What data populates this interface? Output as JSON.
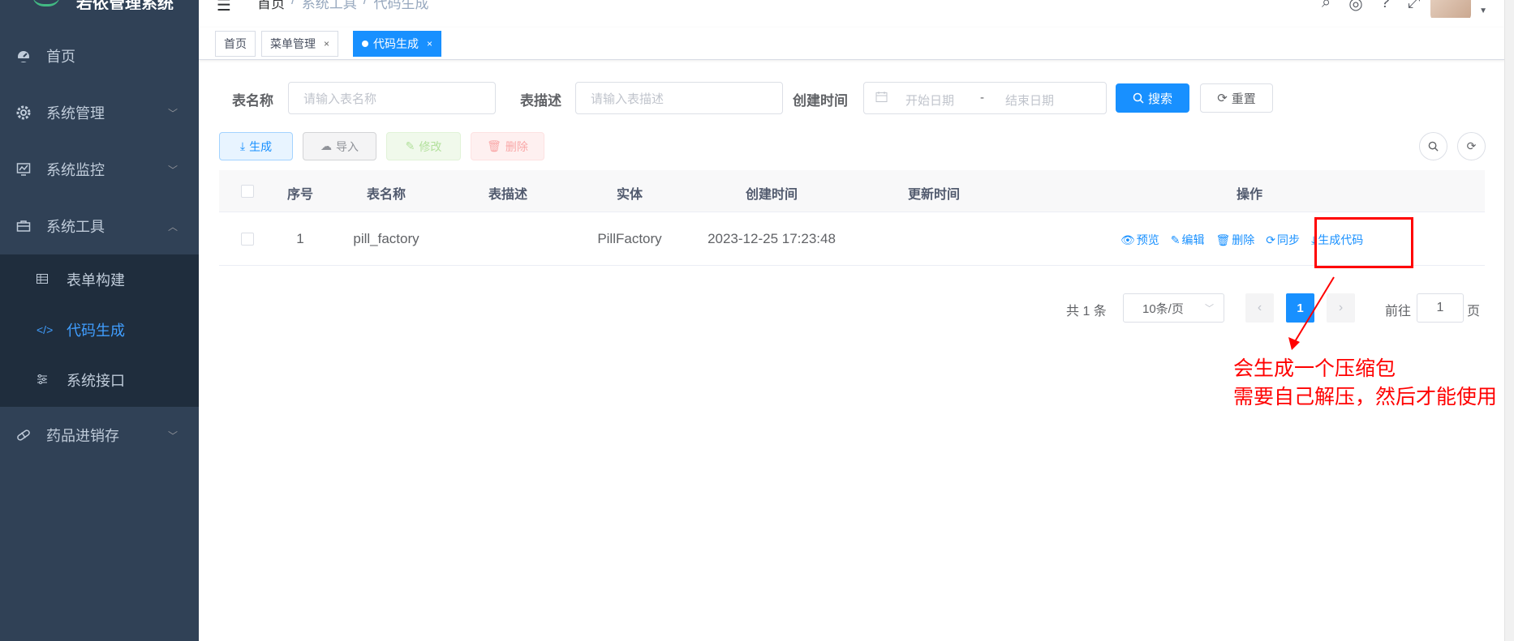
{
  "app": {
    "title": "若依管理系统"
  },
  "sidebar": {
    "items": [
      {
        "label": "首页",
        "icon": "dashboard-icon"
      },
      {
        "label": "系统管理",
        "icon": "gear-icon"
      },
      {
        "label": "系统监控",
        "icon": "monitor-icon"
      },
      {
        "label": "系统工具",
        "icon": "toolbox-icon"
      },
      {
        "label": "药品进销存",
        "icon": "pill-icon"
      }
    ],
    "submenu": [
      {
        "label": "表单构建",
        "icon": "table-icon"
      },
      {
        "label": "代码生成",
        "icon": "code-icon"
      },
      {
        "label": "系统接口",
        "icon": "sliders-icon"
      }
    ]
  },
  "navbar": {
    "breadcrumb": [
      "首页",
      "/",
      "系统工具",
      "/",
      "代码生成"
    ]
  },
  "tags": [
    {
      "label": "首页",
      "closable": false
    },
    {
      "label": "菜单管理",
      "closable": true
    },
    {
      "label": "代码生成",
      "closable": true,
      "active": true
    }
  ],
  "search": {
    "table_name_label": "表名称",
    "table_name_placeholder": "请输入表名称",
    "table_desc_label": "表描述",
    "table_desc_placeholder": "请输入表描述",
    "create_time_label": "创建时间",
    "start_placeholder": "开始日期",
    "range_separator": "-",
    "end_placeholder": "结束日期",
    "search_button": "搜索",
    "reset_button": "重置"
  },
  "toolbar": {
    "generate": "生成",
    "import": "导入",
    "edit": "修改",
    "delete": "删除"
  },
  "table": {
    "columns": [
      "序号",
      "表名称",
      "表描述",
      "实体",
      "创建时间",
      "更新时间",
      "操作"
    ],
    "rows": [
      {
        "index": "1",
        "table_name": "pill_factory",
        "table_desc": "",
        "entity": "PillFactory",
        "create_time": "2023-12-25 17:23:48",
        "update_time": "",
        "actions": [
          "预览",
          "编辑",
          "删除",
          "同步",
          "生成代码"
        ]
      }
    ]
  },
  "pagination": {
    "total_text": "共 1 条",
    "page_size": "10条/页",
    "current_page": "1",
    "goto_label": "前往",
    "goto_value": "1",
    "goto_unit": "页"
  },
  "annotation": {
    "line1": "会生成一个压缩包",
    "line2": "需要自己解压，然后才能使用",
    "color": "#ff0000"
  },
  "colors": {
    "sidebar_bg": "#304156",
    "submenu_bg": "#1f2d3d",
    "primary": "#1890ff",
    "active_menu": "#409eff"
  }
}
